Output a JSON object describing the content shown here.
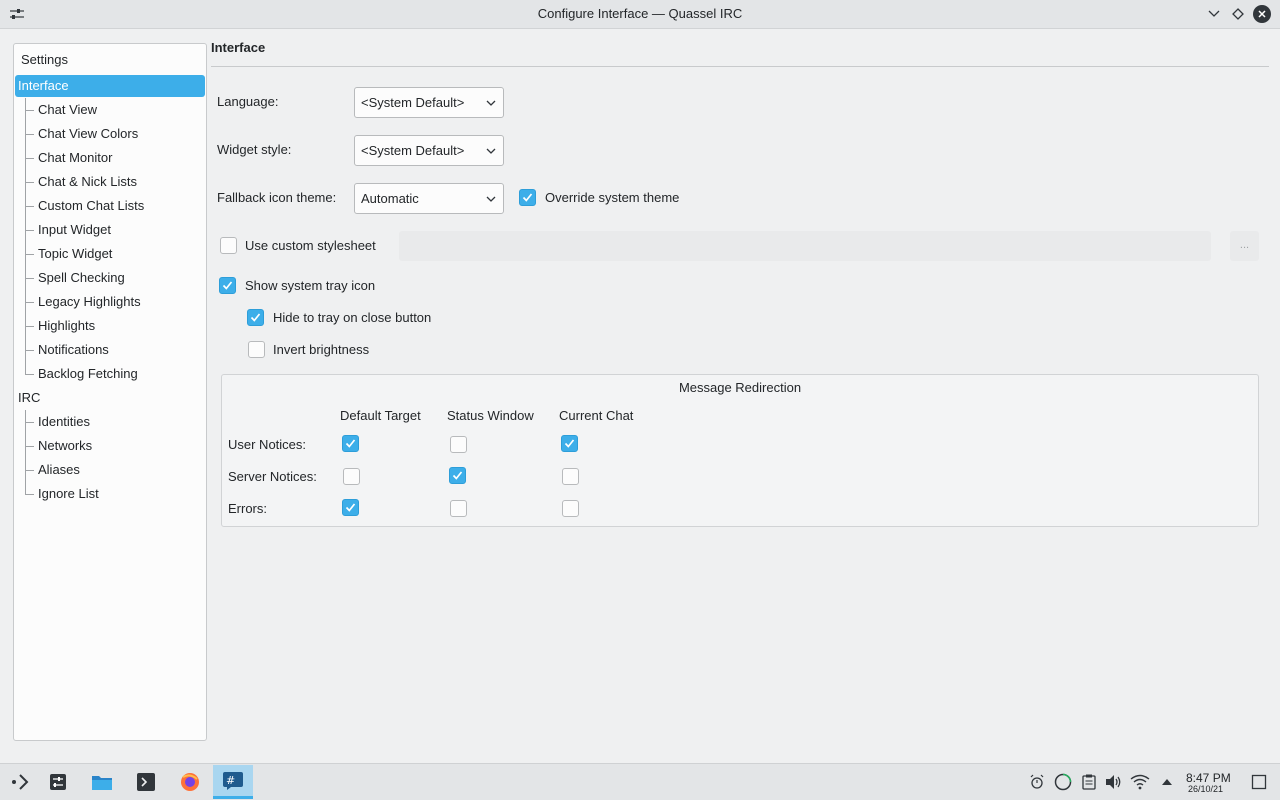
{
  "window": {
    "title": "Configure Interface — Quassel IRC"
  },
  "sidebar": {
    "header": "Settings",
    "items": [
      {
        "label": "Interface",
        "selected": true
      },
      {
        "label": "Chat View"
      },
      {
        "label": "Chat View Colors"
      },
      {
        "label": "Chat Monitor"
      },
      {
        "label": "Chat & Nick Lists"
      },
      {
        "label": "Custom Chat Lists"
      },
      {
        "label": "Input Widget"
      },
      {
        "label": "Topic Widget"
      },
      {
        "label": "Spell Checking"
      },
      {
        "label": "Legacy Highlights"
      },
      {
        "label": "Highlights"
      },
      {
        "label": "Notifications"
      },
      {
        "label": "Backlog Fetching"
      },
      {
        "label": "IRC"
      },
      {
        "label": "Identities"
      },
      {
        "label": "Networks"
      },
      {
        "label": "Aliases"
      },
      {
        "label": "Ignore List"
      }
    ]
  },
  "page": {
    "title": "Interface",
    "language": {
      "label": "Language:",
      "value": "<System Default>"
    },
    "widget_style": {
      "label": "Widget style:",
      "value": "<System Default>"
    },
    "fallback_icon_theme": {
      "label": "Fallback icon theme:",
      "value": "Automatic"
    },
    "override_system_theme": {
      "label": "Override system theme",
      "checked": true
    },
    "use_custom_stylesheet": {
      "label": "Use custom stylesheet",
      "checked": false,
      "browse_label": "..."
    },
    "show_system_tray_icon": {
      "label": "Show system tray icon",
      "checked": true
    },
    "hide_to_tray": {
      "label": "Hide to tray on close button",
      "checked": true
    },
    "invert_brightness": {
      "label": "Invert brightness",
      "checked": false
    }
  },
  "redirection": {
    "title": "Message Redirection",
    "columns": [
      "Default Target",
      "Status Window",
      "Current Chat"
    ],
    "rows": [
      {
        "label": "User Notices:",
        "values": [
          true,
          false,
          true
        ]
      },
      {
        "label": "Server Notices:",
        "values": [
          false,
          true,
          false
        ]
      },
      {
        "label": "Errors:",
        "values": [
          true,
          false,
          false
        ]
      }
    ]
  },
  "taskbar": {
    "time": "8:47 PM",
    "date": "26/10/21",
    "accent": "#3daee9"
  }
}
